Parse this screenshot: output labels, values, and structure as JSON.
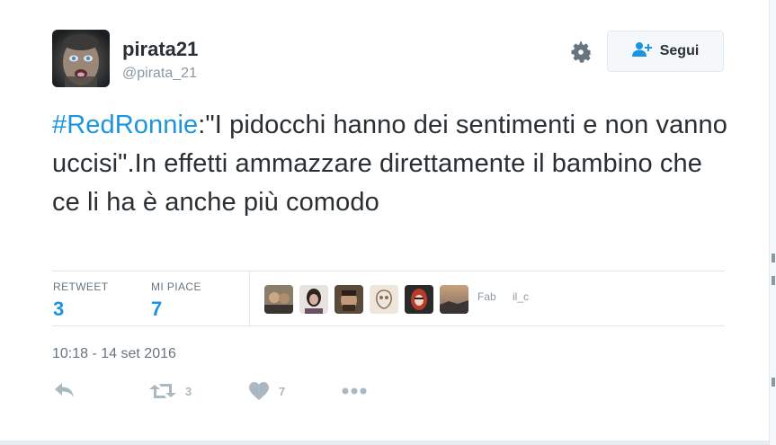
{
  "user": {
    "name": "pirata21",
    "handle": "@pirata_21"
  },
  "follow_button": {
    "label": "Segui"
  },
  "tweet": {
    "hashtag": "#RedRonnie",
    "text": ":\"I pidocchi hanno dei sentimenti e non vanno uccisi\".In effetti ammazzare direttamente il bambino che ce li ha è anche più comodo"
  },
  "stats": {
    "retweet_label": "RETWEET",
    "retweet_count": "3",
    "likes_label": "MI PIACE",
    "likes_count": "7"
  },
  "likers": {
    "names_fragment_1": "Fab",
    "names_fragment_2": "il_c"
  },
  "timestamp": "10:18 - 14 set 2016",
  "actions": {
    "retweet_count": "3",
    "like_count": "7"
  },
  "colors": {
    "accent": "#1b95e0",
    "text": "#292f33",
    "muted": "#8899a6",
    "border": "#e1e8ed"
  },
  "icons": [
    "settings-gear-icon",
    "follow-user-plus-icon",
    "reply-icon",
    "retweet-icon",
    "heart-icon",
    "more-dots-icon"
  ]
}
